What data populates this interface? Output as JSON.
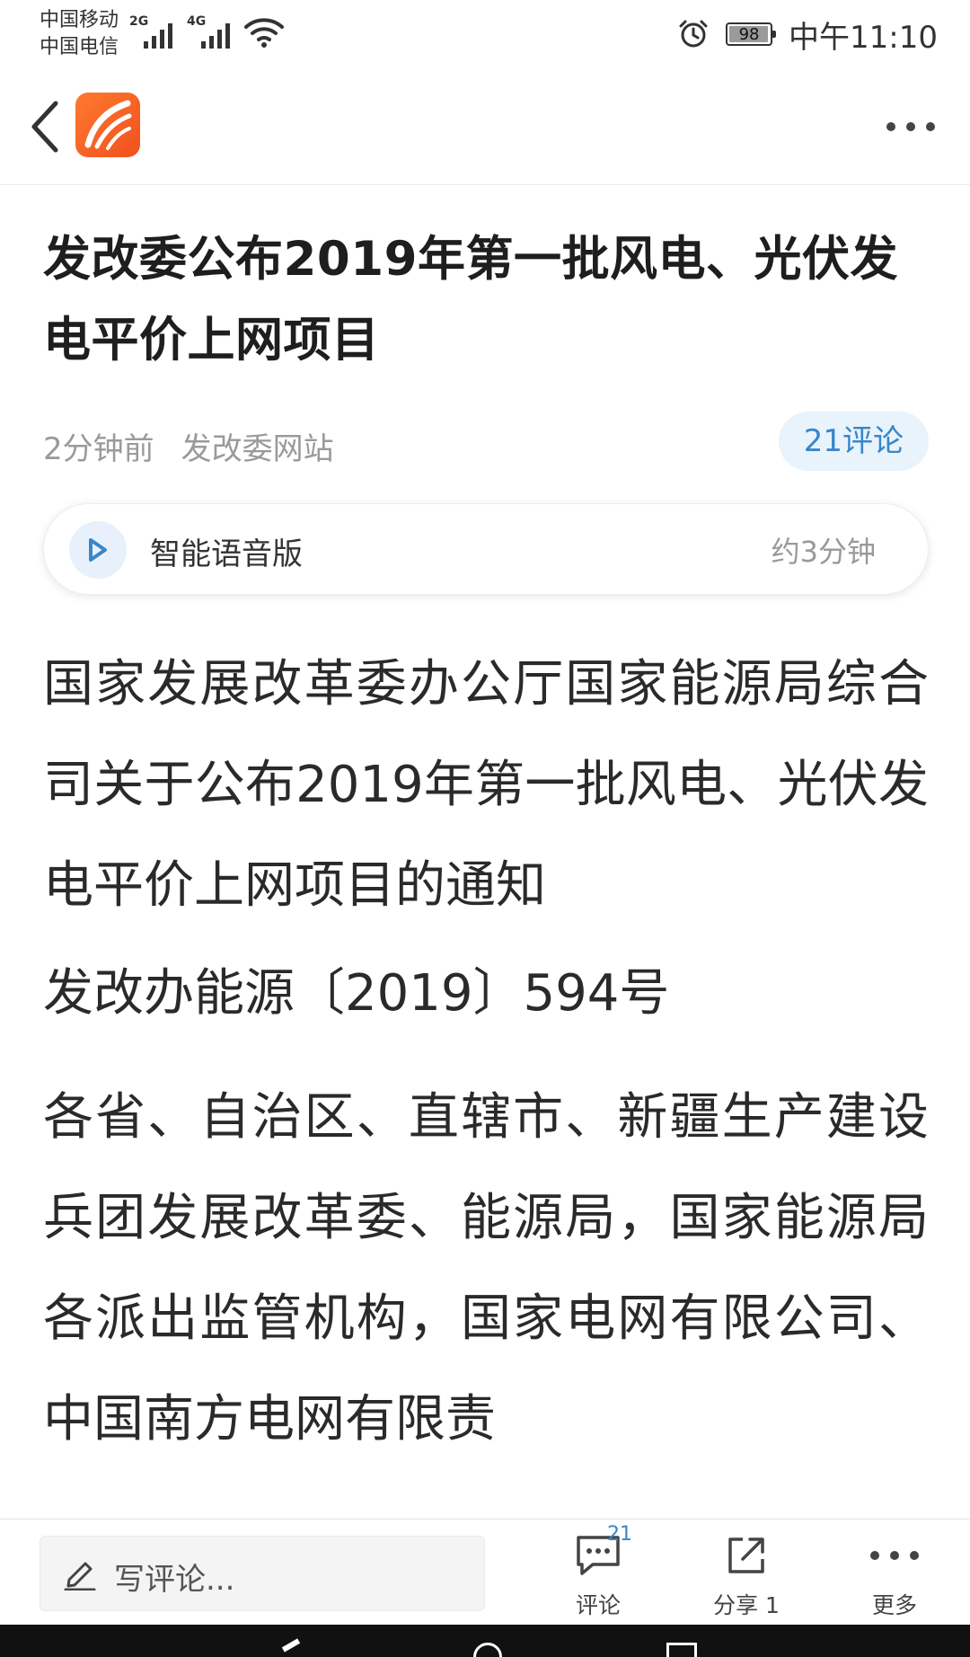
{
  "status_bar": {
    "carrier_1": "中国移动",
    "carrier_2": "中国电信",
    "network_1": "2G",
    "network_2": "4G",
    "battery_level": "98",
    "time": "中午11:10"
  },
  "nav": {
    "back_icon": "chevron-left-icon",
    "logo_icon": "app-logo-icon",
    "more_icon": "more-dots-icon"
  },
  "article": {
    "headline": "发改委公布2019年第一批风电、光伏发电平价上网项目",
    "published": "2分钟前",
    "source": "发改委网站",
    "comment_pill": "21评论",
    "audio": {
      "label": "智能语音版",
      "duration": "约3分钟"
    },
    "paragraphs": {
      "title_line": "国家发展改革委办公厅国家能源局综合司关于公布2019年第一批风电、光伏发电平价上网项目的通知",
      "doc_no": "发改办能源〔2019〕594号",
      "recipients": "各省、自治区、直辖市、新疆生产建设兵团发展改革委、能源局，国家能源局各派出监管机构，国家电网有限公司、中国南方电网有限责"
    }
  },
  "toolbar": {
    "comment_placeholder": "写评论...",
    "comment_label": "评论",
    "comment_count": "21",
    "share_label": "分享 1",
    "more_label": "更多"
  },
  "colors": {
    "accent_blue": "#3a86c8",
    "pill_bg": "#e8f3fc",
    "logo_orange": "#f0501e"
  }
}
